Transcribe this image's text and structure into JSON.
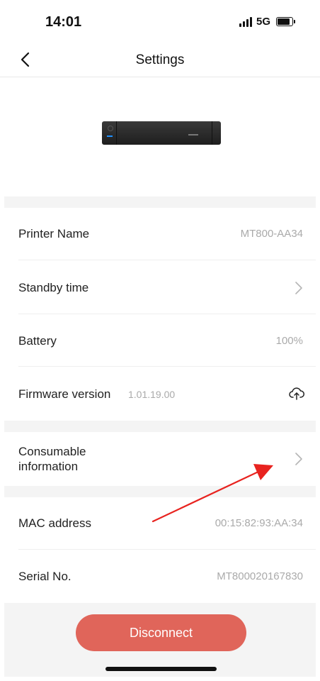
{
  "status": {
    "time": "14:01",
    "network": "5G"
  },
  "nav": {
    "title": "Settings"
  },
  "rows": {
    "printer_name": {
      "label": "Printer Name",
      "value": "MT800-AA34"
    },
    "standby": {
      "label": "Standby time"
    },
    "battery": {
      "label": "Battery",
      "value": "100%"
    },
    "firmware": {
      "label": "Firmware version",
      "value": "1.01.19.00"
    },
    "consumable": {
      "label_line1": "Consumable",
      "label_line2": "information"
    },
    "mac": {
      "label": "MAC address",
      "value": "00:15:82:93:AA:34"
    },
    "serial": {
      "label": "Serial No.",
      "value": "MT800020167830"
    }
  },
  "actions": {
    "disconnect_label": "Disconnect"
  },
  "colors": {
    "accent": "#e0655a",
    "annotation_arrow": "#e8231f"
  }
}
